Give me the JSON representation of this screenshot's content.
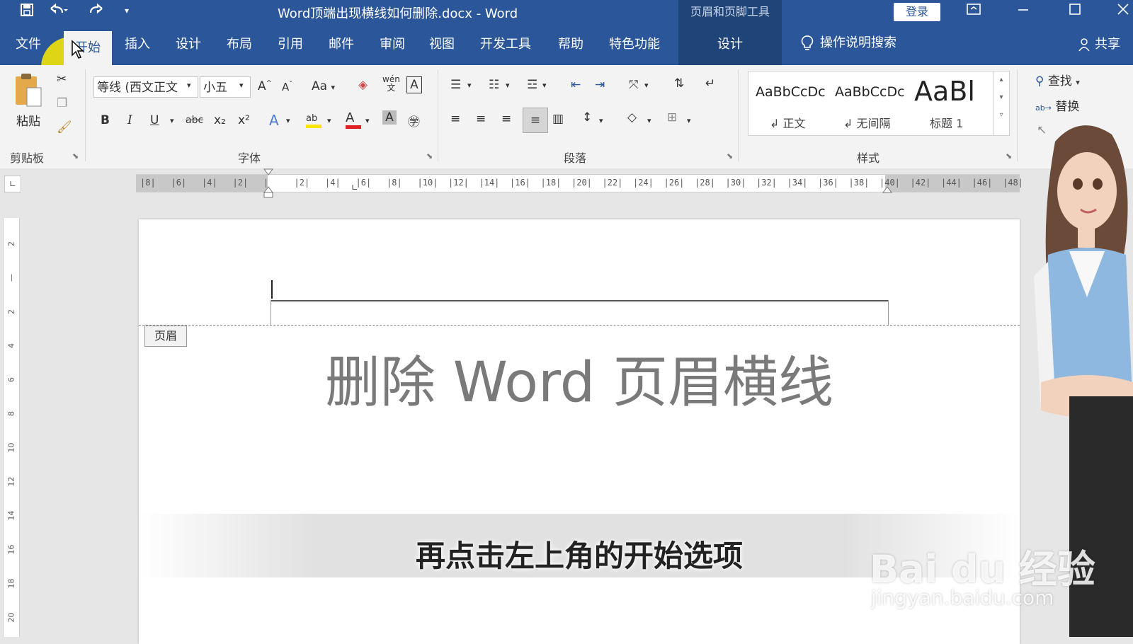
{
  "titlebar": {
    "doc_title": "Word顶端出现横线如何删除.docx  -  Word",
    "context_tool": "页眉和页脚工具",
    "login": "登录",
    "colors": {
      "bar": "#2b579a",
      "context": "#1f4477"
    }
  },
  "tabs": {
    "file": "文件",
    "home": "开始",
    "insert": "插入",
    "design": "设计",
    "layout": "布局",
    "references": "引用",
    "mailings": "邮件",
    "review": "审阅",
    "view": "视图",
    "developer": "开发工具",
    "help": "帮助",
    "special": "特色功能",
    "ctx_design": "设计",
    "tell_me": "操作说明搜索",
    "share": "共享"
  },
  "ribbon": {
    "clipboard": {
      "paste": "粘贴",
      "label": "剪贴板"
    },
    "font": {
      "font_name": "等线 (西文正文",
      "font_size": "小五",
      "grow": "A",
      "shrink": "A",
      "case": "Aa",
      "phonetic": "wén",
      "bold": "B",
      "italic": "I",
      "underline": "U",
      "strike": "abc",
      "sub": "x₂",
      "sup": "x²",
      "label": "字体"
    },
    "paragraph": {
      "label": "段落"
    },
    "styles": {
      "items": [
        {
          "sample": "AaBbCcDc",
          "name": "↲ 正文"
        },
        {
          "sample": "AaBbCcDc",
          "name": "↲ 无间隔"
        },
        {
          "sample": "AaBl",
          "name": "标题 1"
        }
      ],
      "label": "样式"
    },
    "editing": {
      "find": "查找",
      "replace": "替换"
    }
  },
  "ruler": {
    "ticks": [
      "8",
      "6",
      "4",
      "2",
      "",
      "2",
      "4",
      "6",
      "8",
      "10",
      "12",
      "14",
      "16",
      "18",
      "20",
      "22",
      "24",
      "26",
      "28",
      "30",
      "32",
      "34",
      "36",
      "38",
      "40",
      "42",
      "44",
      "46",
      "48"
    ],
    "vticks": [
      "2",
      "",
      "2",
      "4",
      "6",
      "8",
      "10",
      "12",
      "14",
      "16",
      "18",
      "20"
    ]
  },
  "document": {
    "header_tag": "页眉",
    "heading": "删除 Word 页眉横线"
  },
  "subtitle": "再点击左上角的开始选项",
  "watermark": {
    "logo": "Bai du 经验",
    "url": "jingyan.baidu.com"
  }
}
